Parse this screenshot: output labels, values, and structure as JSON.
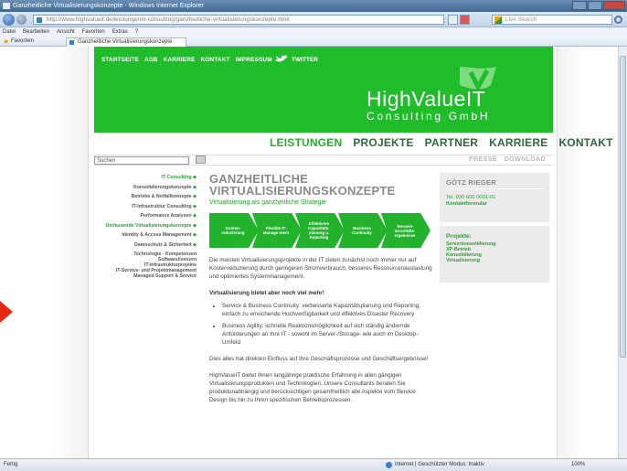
{
  "window": {
    "title": "Ganzheitliche Virtualisierungskonzepte - Windows Internet Explorer"
  },
  "address": {
    "url": "http://www.highvalueit.de/leistungen/it-consulting/ganzheitliche-virtualisierungskonzepte.html",
    "search_placeholder": "Live Search"
  },
  "menu": [
    "Datei",
    "Bearbeiten",
    "Ansicht",
    "Favoriten",
    "Extras",
    "?"
  ],
  "favorites": {
    "label": "Favoriten",
    "tab_title": "Ganzheitliche Virtualisierungskonzepte"
  },
  "status": {
    "left": "Fertig",
    "zone": "Internet | Geschützter Modus: Inaktiv",
    "zoom": "100%"
  },
  "site": {
    "topnav": [
      "STARTSEITE",
      "AGB",
      "KARRIERE",
      "KONTAKT",
      "IMPRESSUM"
    ],
    "twitter": "TWITTER",
    "logo_main": "HighValueIT",
    "logo_sub": "Consulting GmbH",
    "mainnav": [
      "LEISTUNGEN",
      "PROJEKTE",
      "PARTNER",
      "KARRIERE",
      "KONTAKT"
    ],
    "search_placeholder": "Suchen",
    "subnav": [
      "PRESSE",
      "DOWNLOAD"
    ],
    "leftnav": [
      {
        "label": "IT-Consulting",
        "green": true
      },
      {
        "label": "Konsolidierungskonzepte",
        "green": false
      },
      {
        "label": "Betriebs & Notfallkonzepte",
        "green": false
      },
      {
        "label": "IT-Infrastruktur Consulting",
        "green": false
      },
      {
        "label": "Performance Analysen",
        "green": false
      },
      {
        "label": "Umfassende Virtualisierungskonzepte",
        "green": true
      },
      {
        "label": "Identity & Access Management",
        "green": false
      },
      {
        "label": "Datenschutz & Sicherheit",
        "green": false
      }
    ],
    "leftnav_multi": [
      "Technologie - Kompetenzen",
      "Softwarelizenzen",
      "IT-Infrastrukturprojekte",
      "IT-Service- und Projektmanagement",
      "Managed Support & Service"
    ],
    "page_title_1": "GANZHEITLICHE",
    "page_title_2": "VIRTUALISIERUNGSKONZEPTE",
    "subtitle": "Virtualisierung als ganzheitliche Strategie",
    "steps": [
      "Kosten-reduzierung",
      "Flexible IT-Manage-ment",
      "Effektivere Kapazitäts-planung u. Reporting",
      "Business Continuity",
      "Bessere Geschäfts-ergebnisse"
    ],
    "para1": "Die meisten Virtualisierungsprojekte in der IT zielen zunächst noch immer nur auf Kostenreduzierung durch geringeren Stromverbrauch, besseres Ressourcenauslastung und optimiertes Systemmanagement.",
    "para2": "Virtualisierung bietet aber noch viel mehr!",
    "bullets": [
      "Service & Business Continuity: verbesserte Kapazitätsplanung und Reporting, einfach zu erreichende Hochverfügbarkeit und effektives Disaster Recovery",
      "Business Agility: schnelle Reaktionsmöglichkeit auf sich ständig ändernde Anforderungen an Ihre IT - sowohl im Server-/Storage- wie auch im Desktop-Umfeld"
    ],
    "para3": "Dies alles hat direkten Einfluss auf Ihre Geschäftsprozesse und Geschäftsergebnisse!",
    "para4": "HighValueIT bietet Ihnen langjährige praktische Erfahrung in allen gängigen Virtualisierungsprodukten und Technologien. Unsere Consultants beraten Sie produktunabhängig und berücksichtigen gesamtheitlich alle Aspekte vom Service Design bis hin zu Ihren spezifischen Betriebsprozessen.",
    "contact": {
      "name": "GÖTZ RIEGER",
      "tel": "Tel. 030 600 0001-01",
      "form": "Kontaktformular"
    },
    "projects": {
      "title": "Projekte:",
      "items": [
        "Serverkonsolidierung",
        "XP-Betrieb",
        "Konsolidierung",
        "Virtualisierung"
      ]
    }
  }
}
